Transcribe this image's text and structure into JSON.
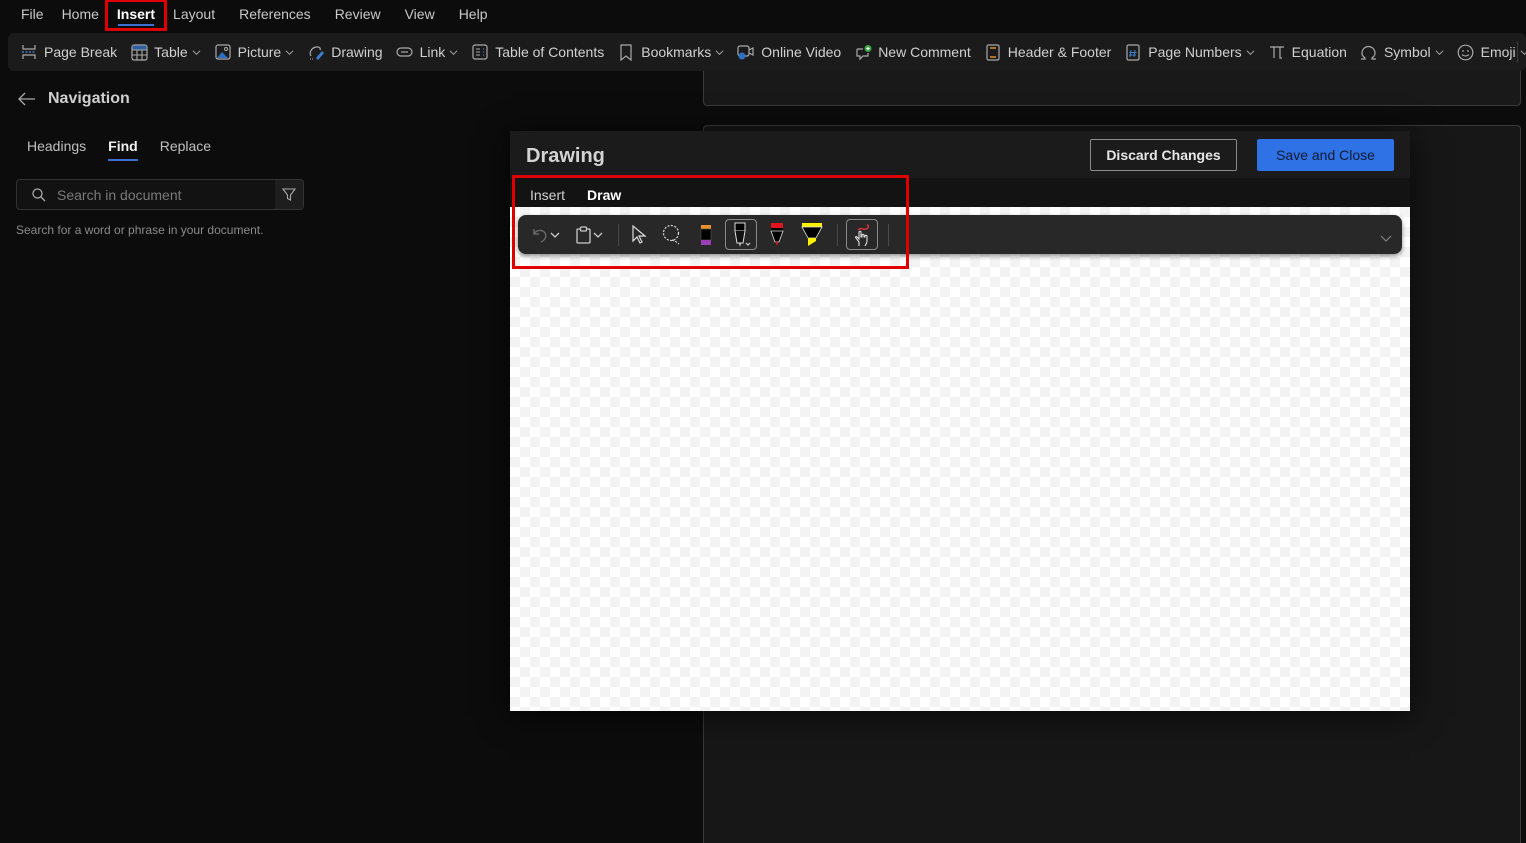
{
  "menu": {
    "items": [
      {
        "label": "File",
        "active": false
      },
      {
        "label": "Home",
        "active": false
      },
      {
        "label": "Insert",
        "active": true
      },
      {
        "label": "Layout",
        "active": false
      },
      {
        "label": "References",
        "active": false
      },
      {
        "label": "Review",
        "active": false
      },
      {
        "label": "View",
        "active": false
      },
      {
        "label": "Help",
        "active": false
      }
    ]
  },
  "ribbon": {
    "page_break": "Page Break",
    "table": "Table",
    "picture": "Picture",
    "drawing": "Drawing",
    "link": "Link",
    "toc": "Table of Contents",
    "bookmarks": "Bookmarks",
    "online_video": "Online Video",
    "new_comment": "New Comment",
    "header_footer": "Header & Footer",
    "page_numbers": "Page Numbers",
    "equation": "Equation",
    "symbol": "Symbol",
    "emoji": "Emoji"
  },
  "navigation": {
    "title": "Navigation",
    "tabs": [
      {
        "label": "Headings",
        "active": false
      },
      {
        "label": "Find",
        "active": true
      },
      {
        "label": "Replace",
        "active": false
      }
    ],
    "search_placeholder": "Search in document",
    "search_value": "",
    "hint": "Search for a word or phrase in your document."
  },
  "drawing_dialog": {
    "title": "Drawing",
    "discard_label": "Discard Changes",
    "save_label": "Save and Close",
    "tabs": [
      {
        "label": "Insert",
        "active": false
      },
      {
        "label": "Draw",
        "active": true
      }
    ],
    "toolbar": {
      "tools": [
        "undo",
        "clipboard",
        "select",
        "lasso-select",
        "eraser",
        "pen-black",
        "pen-red",
        "highlighter-yellow",
        "ink-to-shape"
      ],
      "pen_colors": {
        "black": "#000000",
        "red": "#e0141e",
        "highlighter": "#fff200",
        "eraser_top": "#e8922a",
        "eraser_bottom": "#9b3fb5"
      }
    }
  },
  "colors": {
    "accent": "#2f72e5",
    "annotation": "#e00000"
  }
}
